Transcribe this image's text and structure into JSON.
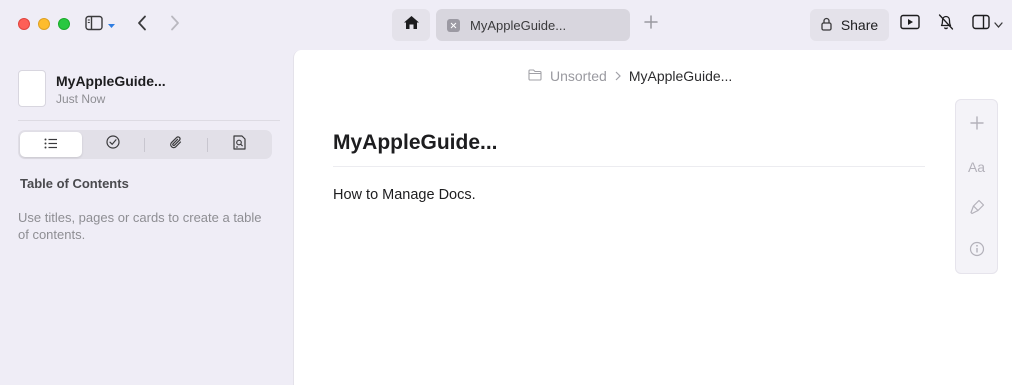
{
  "window": {
    "traffic_lights": {
      "close": "#fe5f57",
      "minimize": "#febc2e",
      "zoom": "#28c840"
    }
  },
  "toolbar": {
    "icons": {
      "sidebar": "sidebar-icon",
      "back": "chevron-left-icon",
      "forward": "chevron-right-icon",
      "home": "house-icon",
      "new_tab": "plus-icon",
      "present": "play-icon",
      "notifications": "bell-slash-icon",
      "panels": "sidebar-right-icon"
    },
    "tab_label": "MyAppleGuide...",
    "share_label": "Share"
  },
  "sidebar": {
    "document": {
      "title": "MyAppleGuide...",
      "subtitle": "Just Now"
    },
    "segments": [
      {
        "icon": "list-icon",
        "active": true
      },
      {
        "icon": "checkmark-circle-icon",
        "active": false
      },
      {
        "icon": "paperclip-icon",
        "active": false
      },
      {
        "icon": "doc-search-icon",
        "active": false
      }
    ],
    "toc": {
      "heading": "Table of Contents",
      "help": "Use titles, pages or cards to create a table of contents."
    }
  },
  "main": {
    "breadcrumb": {
      "folder": "Unsorted",
      "document": "MyAppleGuide..."
    },
    "title": "MyAppleGuide...",
    "body": "How to Manage Docs.",
    "rail": {
      "font_label": "Aa",
      "icons": [
        "plus-icon",
        "font-icon",
        "brush-icon",
        "info-icon"
      ]
    }
  },
  "colors": {
    "background": "#efedf6",
    "content": "#ffffff",
    "muted_text": "#8e8e93"
  }
}
